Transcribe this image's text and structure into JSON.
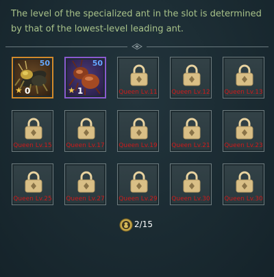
{
  "description": "The level of the specialized ant in the slot is determined by that of the lowest-level leading ant.",
  "ant_slots": [
    {
      "level": "50",
      "stars": "0",
      "frame_color": "#d38a2a"
    },
    {
      "level": "50",
      "stars": "1",
      "frame_color": "#8a5ad0"
    }
  ],
  "locked_slots": [
    "Queen Lv.11",
    "Queen Lv.12",
    "Queen Lv.13",
    "Queen Lv.15",
    "Queen Lv.17",
    "Queen Lv.19",
    "Queen Lv.21",
    "Queen Lv.23",
    "Queen Lv.25",
    "Queen Lv.27",
    "Queen Lv.29",
    "Queen Lv.30",
    "Queen Lv.30"
  ],
  "counter": "2/15",
  "colors": {
    "description_text": "#a9c38a",
    "locked_label": "#d01a1a",
    "level_text": "#64a8ff",
    "background": "#1b2a31"
  },
  "icons": {
    "lock": "padlock-icon",
    "star": "star-icon",
    "counter": "ant-coin-icon"
  }
}
